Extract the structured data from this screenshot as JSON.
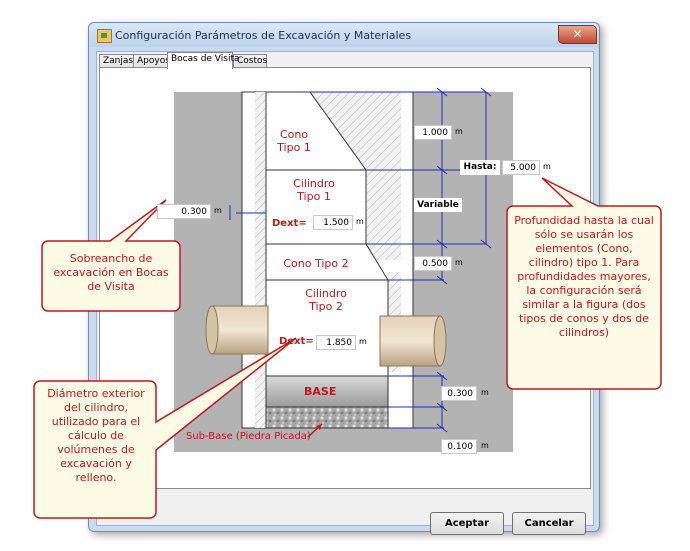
{
  "window": {
    "title": "Configuración Parámetros de Excavación y Materiales",
    "close_glyph": "✕",
    "tabs": [
      {
        "label": "Zanjas"
      },
      {
        "label": "Apoyos"
      },
      {
        "label": "Bocas de Visita",
        "active": true
      },
      {
        "label": "Costos"
      }
    ]
  },
  "figure": {
    "cone1_label": "Cono\nTipo 1",
    "cyl1_label": "Cilindro\nTipo 1",
    "cone2_label": "Cono Tipo 2",
    "cyl2_label": "Cilindro\nTipo 2",
    "dext1_label": "Dext=",
    "dext2_label": "Dext=",
    "base_label": "BASE",
    "subbase_label": "Sub-Base (Piedra Picada)",
    "variable_label": "Variable",
    "hasta_label": "Hasta:",
    "unit": "m"
  },
  "inputs": {
    "cone1_height": "1.000",
    "hasta_depth": "5.000",
    "sobreancho": "0.300",
    "dext_cyl1": "1.500",
    "cone2_height": "0.500",
    "dext_cyl2": "1.850",
    "base_height": "0.300",
    "subbase_height": "0.100"
  },
  "callouts": {
    "sobreancho": "Sobreancho de excavación en Bocas de Visita",
    "diametro": "Diámetro exterior del cilindro, utilizado para el cálculo de volúmenes de excavación y relleno.",
    "profundidad": "Profundidad hasta la cual sólo se usarán los elementos (Cono, cilindro) tipo 1. Para profundidades mayores, la configuración será similar a la figura (dos tipos de conos y dos de cilindros)"
  },
  "buttons": {
    "accept": "Aceptar",
    "cancel": "Cancelar"
  },
  "colors": {
    "callout_fill": "#fdfbe6",
    "callout_border": "#c0171d",
    "label_red": "#c0171d",
    "dimension_blue": "#1f2fb3"
  }
}
